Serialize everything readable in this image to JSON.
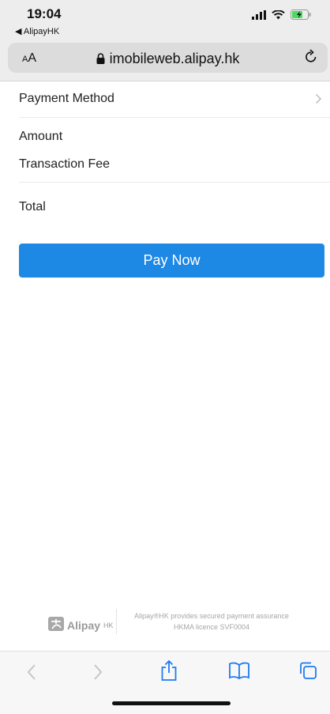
{
  "status_bar": {
    "time": "19:04",
    "back_app": "◀ AlipayHK"
  },
  "browser": {
    "text_size_label": "A",
    "text_size_big": "A",
    "url": "imobileweb.alipay.hk"
  },
  "payment": {
    "payment_method_label": "Payment Method",
    "amount_label": "Amount",
    "transaction_fee_label": "Transaction Fee",
    "total_label": "Total",
    "pay_button": "Pay Now"
  },
  "footer": {
    "brand": "Alipay",
    "brand_suffix": "HK",
    "assurance_line": "Alipay®HK provides secured payment assurance",
    "licence_line": "HKMA licence SVF0004"
  },
  "colors": {
    "accent": "#1e88e5",
    "battery": "#4cd964"
  }
}
